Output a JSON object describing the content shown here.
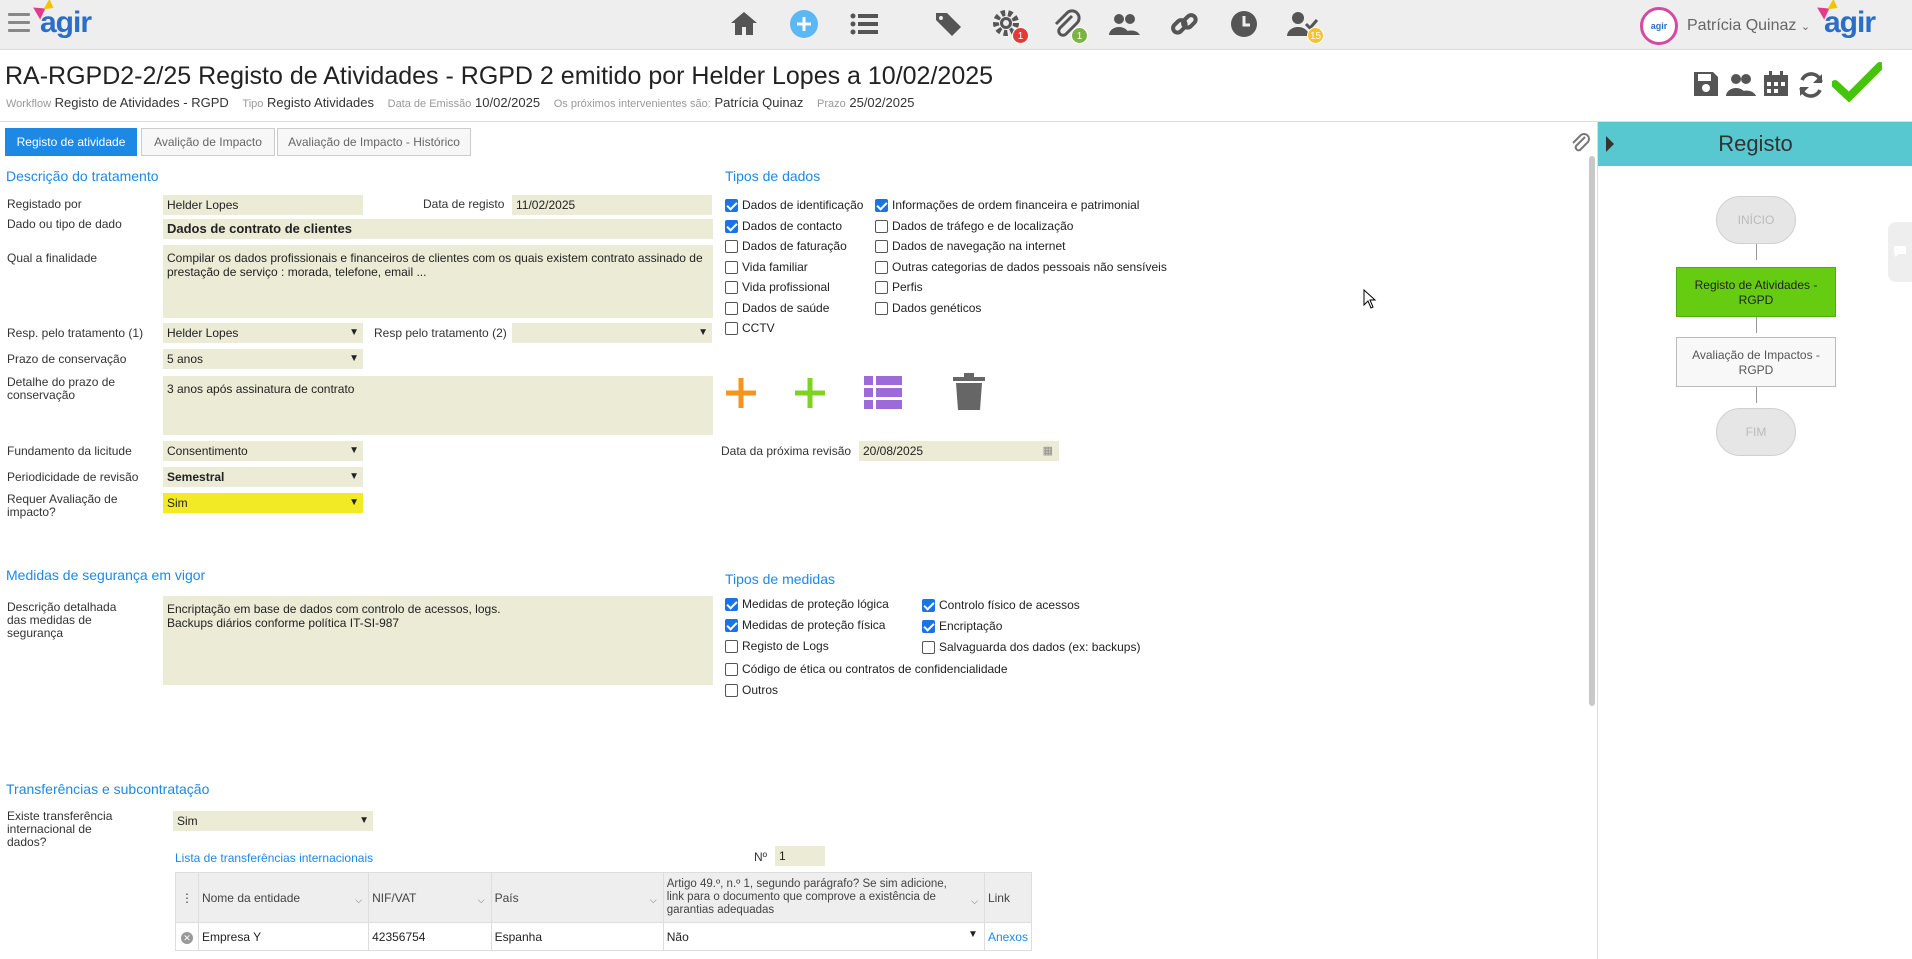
{
  "app": {
    "brand": "agir",
    "user_name": "Patrícia Quinaz"
  },
  "nav": {
    "badges": {
      "settings": "1",
      "attachments": "1",
      "tasks": "15"
    },
    "colors": {
      "settings_badge": "#e53935",
      "attachments_badge": "#7cb342",
      "tasks_badge": "#fbc02d",
      "plus": "#5bb8f5"
    }
  },
  "header": {
    "title": "RA-RGPD2-2/25 Registo de Atividades - RGPD 2 emitido por Helder Lopes a 10/02/2025",
    "workflow_label": "Workflow",
    "workflow_value": "Registo de Atividades - RGPD",
    "tipo_label": "Tipo",
    "tipo_value": "Registo Atividades",
    "emissao_label": "Data de Emissão",
    "emissao_value": "10/02/2025",
    "intervenientes_label": "Os próximos intervenientes são:",
    "intervenientes_value": "Patrícia Quinaz",
    "prazo_label": "Prazo",
    "prazo_value": "25/02/2025"
  },
  "tabs": [
    "Registo de atividade",
    "Avalição de Impacto",
    "Avaliação de Impacto - Histórico"
  ],
  "descricao": {
    "section_title": "Descrição do tratamento",
    "registado_por_label": "Registado por",
    "registado_por_value": "Helder Lopes",
    "data_registo_label": "Data de registo",
    "data_registo_value": "11/02/2025",
    "dado_label": "Dado ou tipo de dado",
    "dado_value": "Dados de contrato de clientes",
    "finalidade_label": "Qual a finalidade",
    "finalidade_value": "Compilar os dados profissionais e financeiros de clientes com os quais existem contrato assinado de prestação de serviço : morada, telefone, email ...",
    "resp1_label": "Resp. pelo tratamento (1)",
    "resp1_value": "Helder Lopes",
    "resp2_label": "Resp pelo tratamento (2)",
    "resp2_value": "",
    "prazo_conservacao_label": "Prazo de conservação",
    "prazo_conservacao_value": "5 anos",
    "detalhe_prazo_label": "Detalhe do prazo de conservação",
    "detalhe_prazo_value": "3 anos após assinatura de contrato",
    "fundamento_label": "Fundamento da licitude",
    "fundamento_value": "Consentimento",
    "periodicidade_label": "Periodicidade de revisão",
    "periodicidade_value": "Semestral",
    "requer_label": "Requer Avaliação de impacto?",
    "requer_value": "Sim",
    "proxima_revisao_label": "Data da próxima revisão",
    "proxima_revisao_value": "20/08/2025"
  },
  "tipos_dados": {
    "section_title": "Tipos de dados",
    "col1": [
      {
        "label": "Dados de identificação",
        "checked": true
      },
      {
        "label": "Dados de contacto",
        "checked": true
      },
      {
        "label": "Dados de faturação",
        "checked": false
      },
      {
        "label": "Vida familiar",
        "checked": false
      },
      {
        "label": "Vida profissional",
        "checked": false
      },
      {
        "label": "Dados de saúde",
        "checked": false
      },
      {
        "label": "CCTV",
        "checked": false
      }
    ],
    "col2": [
      {
        "label": "Informações de ordem financeira e patrimonial",
        "checked": true
      },
      {
        "label": "Dados de tráfego e de localização",
        "checked": false
      },
      {
        "label": "Dados de navegação na internet",
        "checked": false
      },
      {
        "label": "Outras categorias de dados pessoais não sensíveis",
        "checked": false
      },
      {
        "label": "Perfis",
        "checked": false
      },
      {
        "label": "Dados genéticos",
        "checked": false
      }
    ]
  },
  "medidas": {
    "section_title": "Medidas de segurança em vigor",
    "descricao_label": "Descrição detalhada das medidas de segurança",
    "descricao_value": "Encriptação em base de dados com controlo de acessos, logs.\nBackups diários conforme política IT-SI-987"
  },
  "tipos_medidas": {
    "section_title": "Tipos de medidas",
    "col1": [
      {
        "label": "Medidas de proteção lógica",
        "checked": true
      },
      {
        "label": "Medidas de proteção física",
        "checked": true
      },
      {
        "label": "Registo de Logs",
        "checked": false
      }
    ],
    "col2": [
      {
        "label": "Controlo físico de acessos",
        "checked": true
      },
      {
        "label": "Encriptação",
        "checked": true
      },
      {
        "label": "Salvaguarda dos dados (ex: backups)",
        "checked": false
      }
    ],
    "extra": [
      {
        "label": "Código de ética ou contratos de confidencialidade",
        "checked": false
      },
      {
        "label": "Outros",
        "checked": false
      }
    ]
  },
  "transferencias": {
    "section_title": "Transferências e subcontratação",
    "existe_label": "Existe transferência internacional de dados?",
    "existe_value": "Sim",
    "lista_label": "Lista de transferências internacionais",
    "n_label": "Nº",
    "n_value": "1",
    "columns": [
      "Nome da entidade",
      "NIF/VAT",
      "País",
      "Artigo 49.º, n.º 1, segundo parágrafo? Se sim adicione, link para o documento que comprove a existência de garantias adequadas",
      "Link"
    ],
    "rows": [
      {
        "nome": "Empresa Y",
        "nif": "42356754",
        "pais": "Espanha",
        "artigo": "Não",
        "link": "Anexos"
      }
    ]
  },
  "workflow_panel": {
    "title": "Registo",
    "steps": [
      "INÍCIO",
      "Registo de Atividades - RGPD",
      "Avaliação de Impactos - RGPD",
      "FIM"
    ]
  }
}
